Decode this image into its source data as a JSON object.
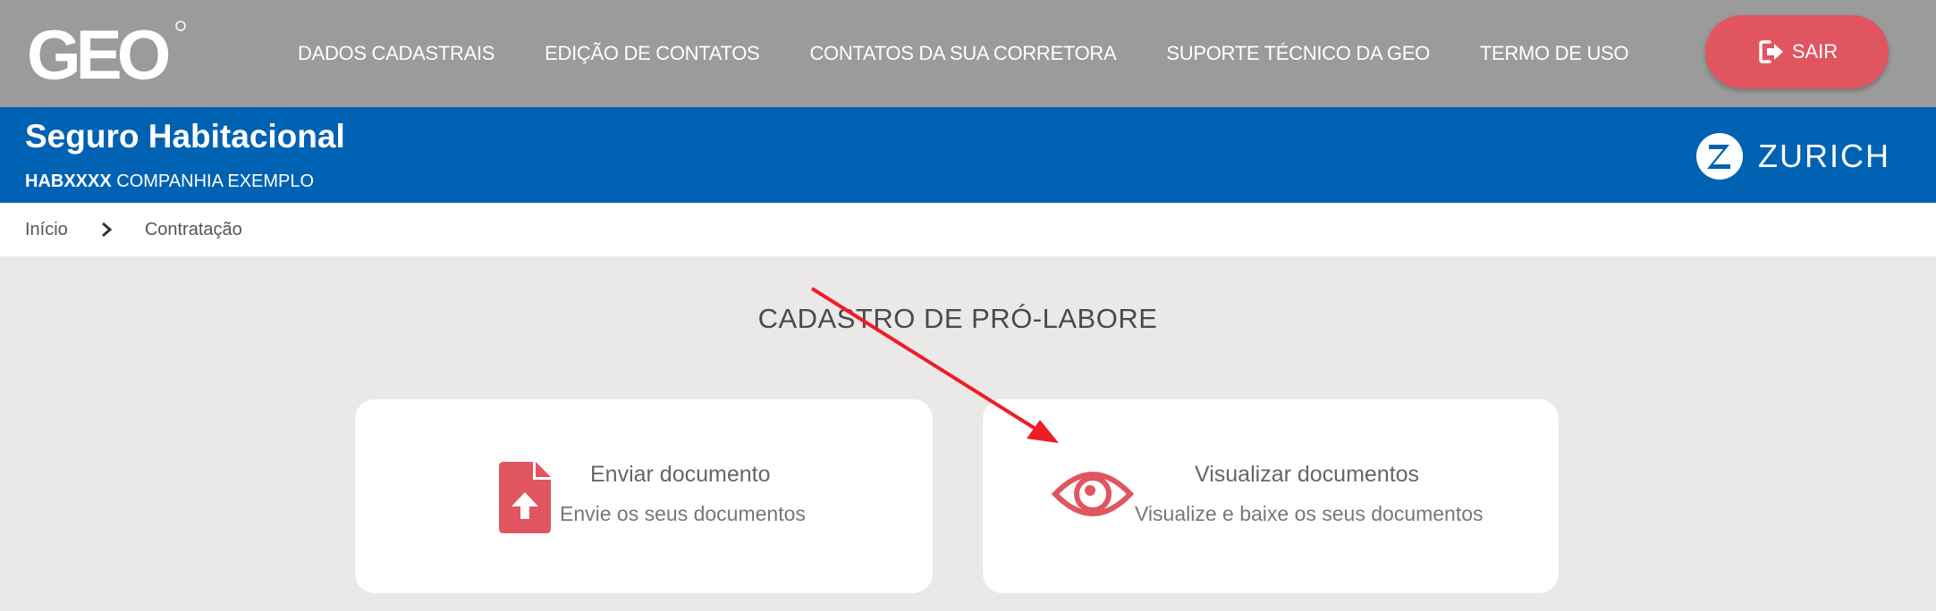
{
  "header": {
    "logo_text": "GEO",
    "nav": [
      {
        "label": "DADOS CADASTRAIS"
      },
      {
        "label": "EDIÇÃO DE CONTATOS"
      },
      {
        "label": "CONTATOS DA SUA CORRETORA"
      },
      {
        "label": "SUPORTE TÉCNICO DA GEO"
      },
      {
        "label": "TERMO DE USO"
      }
    ],
    "logout_label": "SAIR",
    "logout_icon": "sign-out-icon"
  },
  "banner": {
    "title": "Seguro Habitacional",
    "code": "HABXXXX",
    "company": "COMPANHIA EXEMPLO",
    "insurer": "ZURICH"
  },
  "breadcrumb": [
    "Início",
    "Contratação"
  ],
  "page": {
    "title": "CADASTRO DE PRÓ-LABORE",
    "cards": [
      {
        "title": "Enviar documento",
        "subtitle": "Envie os seus documentos",
        "icon": "file-upload-icon"
      },
      {
        "title": "Visualizar documentos",
        "subtitle": "Visualize e baixe os seus documentos",
        "icon": "eye-icon"
      }
    ]
  },
  "colors": {
    "topbar": "#9b9b9b",
    "banner": "#0062b3",
    "accent": "#e0555f",
    "background": "#ebe8e8",
    "annotation_arrow": "#ee1c25"
  }
}
